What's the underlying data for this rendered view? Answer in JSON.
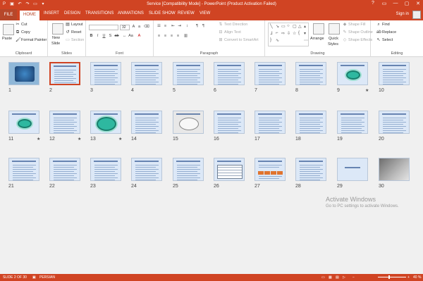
{
  "window": {
    "title": "Service [Compatibility Mode] - PowerPoint (Product Activation Failed)",
    "controls": [
      "?",
      "▭",
      "—",
      "▢",
      "✕"
    ]
  },
  "tabs": [
    {
      "label": "FILE"
    },
    {
      "label": "HOME"
    },
    {
      "label": "INSERT"
    },
    {
      "label": "DESIGN"
    },
    {
      "label": "TRANSITIONS"
    },
    {
      "label": "ANIMATIONS"
    },
    {
      "label": "SLIDE SHOW"
    },
    {
      "label": "REVIEW"
    },
    {
      "label": "VIEW"
    }
  ],
  "active_tab": "HOME",
  "signin": "Sign in",
  "ribbon": {
    "clipboard": {
      "label": "Clipboard",
      "paste": "Paste",
      "cut": "Cut",
      "copy": "Copy",
      "format_painter": "Format Painter"
    },
    "slides": {
      "label": "Slides",
      "new_slide": "New",
      "new_slide2": "Slide",
      "layout": "Layout",
      "reset": "Reset",
      "section": "Section"
    },
    "font": {
      "label": "Font",
      "font_size": "32"
    },
    "paragraph": {
      "label": "Paragraph",
      "text_direction": "Text Direction",
      "align_text": "Align Text",
      "convert": "Convert to SmartArt"
    },
    "drawing": {
      "label": "Drawing",
      "arrange": "Arrange",
      "quick_styles": "Quick",
      "quick_styles2": "Styles",
      "shape_fill": "Shape Fill",
      "shape_outline": "Shape Outline",
      "shape_effects": "Shape Effects"
    },
    "editing": {
      "label": "Editing",
      "find": "Find",
      "replace": "Replace",
      "select": "Select"
    }
  },
  "slides": [
    {
      "n": "1",
      "star": "",
      "kind": "photo"
    },
    {
      "n": "2",
      "star": "",
      "kind": "text",
      "selected": true
    },
    {
      "n": "3",
      "star": "",
      "kind": "text"
    },
    {
      "n": "4",
      "star": "",
      "kind": "text"
    },
    {
      "n": "5",
      "star": "",
      "kind": "text"
    },
    {
      "n": "6",
      "star": "",
      "kind": "text"
    },
    {
      "n": "7",
      "star": "",
      "kind": "text"
    },
    {
      "n": "8",
      "star": "",
      "kind": "text"
    },
    {
      "n": "9",
      "star": "★",
      "kind": "oval"
    },
    {
      "n": "10",
      "star": "",
      "kind": "text"
    },
    {
      "n": "11",
      "star": "★",
      "kind": "oval"
    },
    {
      "n": "12",
      "star": "★",
      "kind": "text"
    },
    {
      "n": "13",
      "star": "★",
      "kind": "oval-big"
    },
    {
      "n": "14",
      "star": "",
      "kind": "text"
    },
    {
      "n": "15",
      "star": "",
      "kind": "diagram"
    },
    {
      "n": "16",
      "star": "",
      "kind": "text"
    },
    {
      "n": "17",
      "star": "",
      "kind": "text"
    },
    {
      "n": "18",
      "star": "",
      "kind": "text"
    },
    {
      "n": "19",
      "star": "",
      "kind": "text"
    },
    {
      "n": "20",
      "star": "",
      "kind": "text"
    },
    {
      "n": "21",
      "star": "",
      "kind": "text"
    },
    {
      "n": "22",
      "star": "",
      "kind": "text"
    },
    {
      "n": "23",
      "star": "",
      "kind": "text"
    },
    {
      "n": "24",
      "star": "",
      "kind": "text"
    },
    {
      "n": "25",
      "star": "",
      "kind": "text"
    },
    {
      "n": "26",
      "star": "",
      "kind": "table"
    },
    {
      "n": "27",
      "star": "",
      "kind": "chevrons"
    },
    {
      "n": "28",
      "star": "",
      "kind": "text"
    },
    {
      "n": "29",
      "star": "",
      "kind": "title-only"
    },
    {
      "n": "30",
      "star": "",
      "kind": "photo2"
    }
  ],
  "activation": {
    "title": "Activate Windows",
    "subtitle": "Go to PC settings to activate Windows."
  },
  "status": {
    "slide": "SLIDE 2 OF 30",
    "language": "PERSIAN",
    "zoom": "40 %",
    "zoom_fraction": 0.4
  },
  "colors": {
    "accent": "#d04423",
    "thumb_bg": "#dce8f7",
    "oval": "#2eb8a0"
  }
}
